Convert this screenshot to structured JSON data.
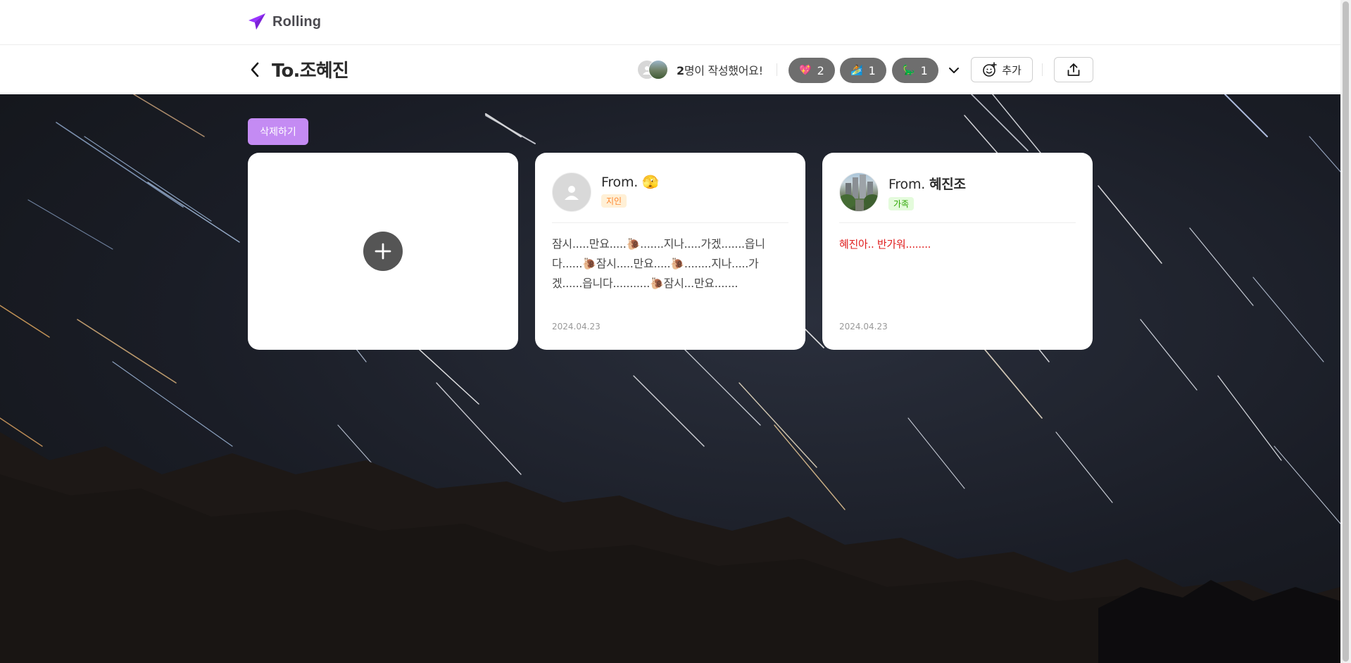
{
  "app": {
    "name": "Rolling"
  },
  "header": {
    "title": "To.조혜진",
    "writer_count": "2",
    "writer_suffix": "명이 작성했어요!",
    "reactions": [
      {
        "emoji": "💖",
        "count": "2"
      },
      {
        "emoji": "🏄",
        "count": "1"
      },
      {
        "emoji": "🦕",
        "count": "1"
      }
    ],
    "add_label": "추가"
  },
  "actions": {
    "delete_label": "삭제하기"
  },
  "cards": [
    {
      "from_prefix": "From.",
      "from_name": "🫣",
      "relation": "지인",
      "message": "잠시.....만요.....🐌.......지나.....가겠.......읍니다......🐌잠시.....만요.....🐌........지나.....가겠......읍니다...........🐌잠시...만요.......",
      "date": "2024.04.23",
      "font_color": "#4a4a4a"
    },
    {
      "from_prefix": "From.",
      "from_name": "혜진조",
      "relation": "가족",
      "message": "혜진아.. 반가워........",
      "date": "2024.04.23",
      "font_color": "#e02020"
    }
  ],
  "colors": {
    "brand": "#9935ff",
    "delete_button": "#c48bf3",
    "reaction_bg": "#6e6e6e"
  }
}
